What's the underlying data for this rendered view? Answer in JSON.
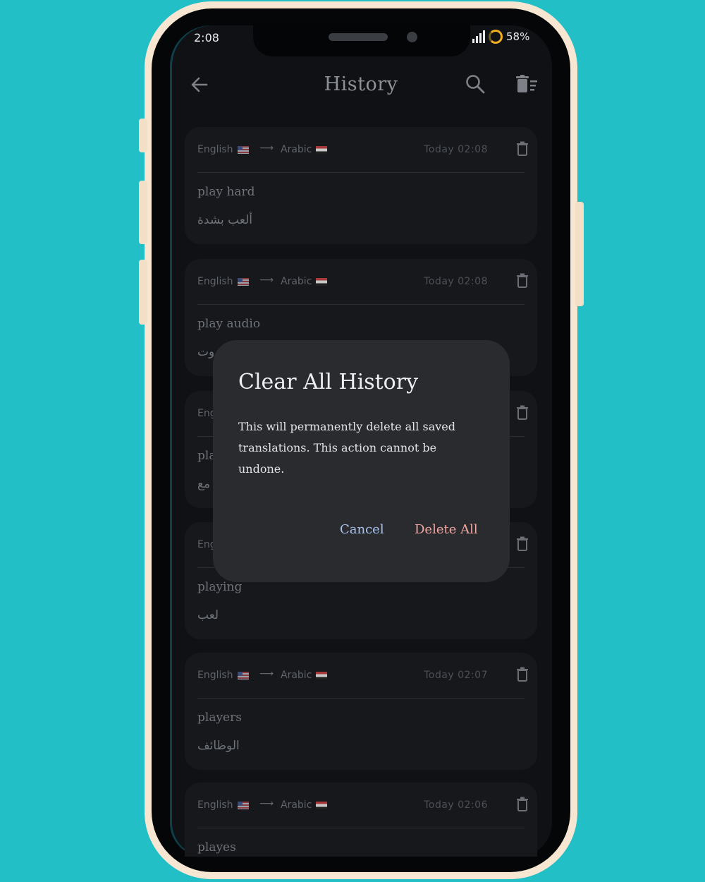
{
  "status_bar": {
    "time": "2:08",
    "battery": "58%"
  },
  "header": {
    "title": "History"
  },
  "history": [
    {
      "source_lang": "English",
      "target_lang": "Arabic",
      "time": "Today 02:08",
      "source_text": "play hard",
      "translated_text": "ألعب بشدة"
    },
    {
      "source_lang": "English",
      "target_lang": "Arabic",
      "time": "Today 02:08",
      "source_text": "play audio",
      "translated_text": "وت"
    },
    {
      "source_lang": "Eng",
      "target_lang": "",
      "time": "",
      "source_text": "pla",
      "translated_text": "مع"
    },
    {
      "source_lang": "Eng",
      "target_lang": "",
      "time": "",
      "source_text": "playing",
      "translated_text": "لعب"
    },
    {
      "source_lang": "English",
      "target_lang": "Arabic",
      "time": "Today 02:07",
      "source_text": "players",
      "translated_text": "الوظائف"
    },
    {
      "source_lang": "English",
      "target_lang": "Arabic",
      "time": "Today 02:06",
      "source_text": "playes",
      "translated_text": ""
    }
  ],
  "dialog": {
    "title": "Clear All History",
    "message": "This will permanently delete all saved translations. This action cannot be undone.",
    "cancel_label": "Cancel",
    "confirm_label": "Delete All"
  },
  "colors": {
    "background": "#22bfc7",
    "frame": "#f6e6d2",
    "dialog": "#2a2b2f",
    "cancel": "#a9c2f0",
    "delete": "#f2a6a0"
  }
}
